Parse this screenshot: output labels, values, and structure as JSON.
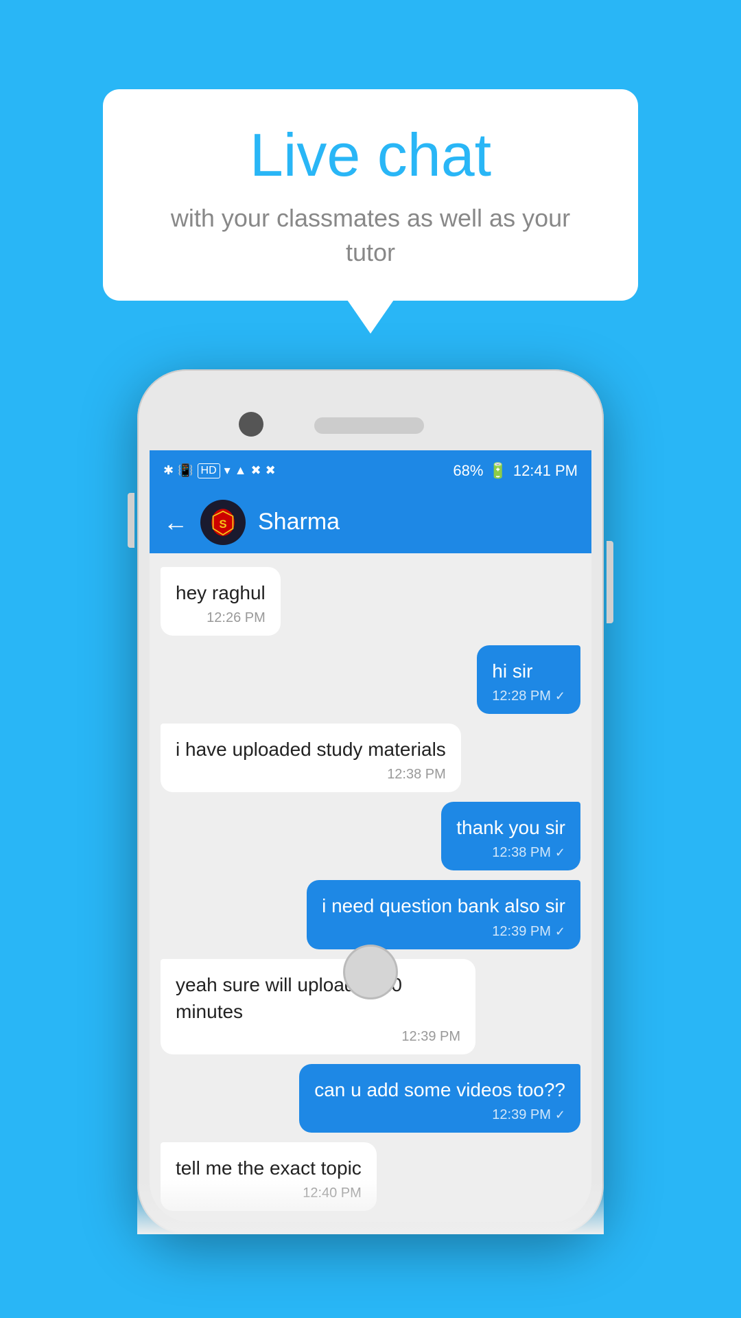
{
  "background_color": "#29b6f6",
  "bubble": {
    "title": "Live chat",
    "subtitle": "with your classmates as well as your tutor"
  },
  "phone": {
    "status_bar": {
      "time": "12:41 PM",
      "battery": "68%",
      "signal_icons": "🔵 📶 📶"
    },
    "header": {
      "contact_name": "Sharma",
      "back_label": "←"
    },
    "messages": [
      {
        "id": 1,
        "type": "incoming",
        "text": "hey raghul",
        "time": "12:26 PM",
        "read": false
      },
      {
        "id": 2,
        "type": "outgoing",
        "text": "hi sir",
        "time": "12:28 PM",
        "read": true
      },
      {
        "id": 3,
        "type": "incoming",
        "text": "i have uploaded study materials",
        "time": "12:38 PM",
        "read": false
      },
      {
        "id": 4,
        "type": "outgoing",
        "text": "thank you sir",
        "time": "12:38 PM",
        "read": true
      },
      {
        "id": 5,
        "type": "outgoing",
        "text": "i need question bank also sir",
        "time": "12:39 PM",
        "read": true
      },
      {
        "id": 6,
        "type": "incoming",
        "text": "yeah sure will upload in 10 minutes",
        "time": "12:39 PM",
        "read": false
      },
      {
        "id": 7,
        "type": "outgoing",
        "text": "can u add some videos too??",
        "time": "12:39 PM",
        "read": true
      },
      {
        "id": 8,
        "type": "incoming",
        "text": "tell me the exact topic",
        "time": "12:40 PM",
        "read": false
      }
    ]
  }
}
